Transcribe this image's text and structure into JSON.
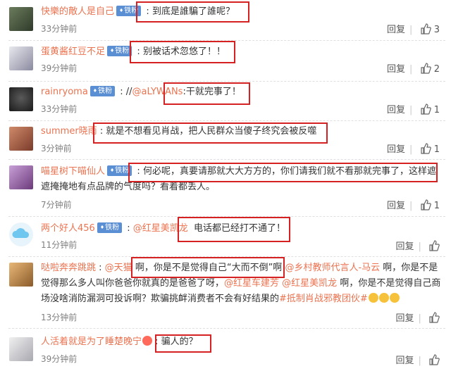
{
  "reply_label": "回复",
  "comments": [
    {
      "user": "快樂的敵人是自己",
      "badge": "铁粉",
      "text": "到底是誰騙了誰呢？",
      "time": "33分钟前",
      "likes": "3"
    },
    {
      "user": "蛋黄酱红豆不足",
      "badge": "铁粉",
      "text": "别被话术忽悠了！！",
      "time": "39分钟前",
      "likes": "2"
    },
    {
      "user": "rainryoma",
      "badge": "铁粉",
      "prefix": "//",
      "mention": "@aLYWANs",
      "text": ":干就完事了！",
      "time": "33分钟前",
      "likes": "1"
    },
    {
      "user": "summer晓雨",
      "badge": "",
      "text": "就是不想看见肖战，把人民群众当傻子终究会被反噬",
      "time": "3分钟前",
      "likes": "1"
    },
    {
      "user": "喵星树下喵仙人",
      "badge": "铁粉",
      "text": "何必呢，真要请那就大大方方的，你们请我们就不看那就完事了，这样遮遮掩掩地有点品牌的气度吗？看着都丢人。",
      "time": "7分钟前",
      "likes": "1"
    },
    {
      "user": "两个好人456",
      "badge": "铁粉",
      "mention": "@红星美凯龙",
      "text": "电话都已经打不通了！",
      "time": "11分钟前"
    },
    {
      "user": "哒啦奔奔跳跳",
      "badge": "",
      "mention1": "@天猫",
      "text1": "啊，你是不是觉得自己“大而不倒”啊",
      "mention2": "@乡村教师代言人-马云",
      "text2": "啊，你是不是觉得那么多人叫你爸爸你就真的是爸爸了呀，",
      "mention3": "@红星车建芳",
      "mention4": "@红星美凯龙",
      "text3": "啊，你是不是觉得自己商场没啥消防漏洞可投诉啊？欺骗挑衅消费者不会有好结果的",
      "topic": "#抵制肖战邪教团伙#",
      "time": "13分钟前"
    },
    {
      "user": "人活着就是为了睡楚晚宁",
      "badge": "",
      "text": "骗人的？",
      "time": "39分钟前"
    }
  ]
}
